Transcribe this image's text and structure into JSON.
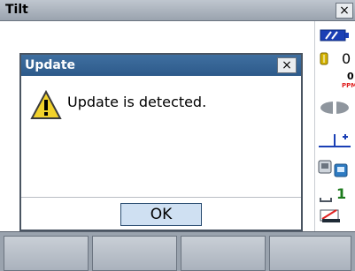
{
  "window": {
    "title": "Tilt",
    "close_glyph": "×"
  },
  "dialog": {
    "title": "Update",
    "close_glyph": "×",
    "message": "Update is detected.",
    "icon": "warning-icon"
  },
  "buttons": {
    "ok": "OK"
  },
  "sidebar": {
    "icons": [
      "battery-icon",
      "target-icon",
      "ppm-icon",
      "prism-icon",
      "tilt-icon",
      "level-icon",
      "page-indicator-icon",
      "no-edit-icon"
    ],
    "target_value": "0",
    "ppm_value": "0",
    "ppm_label": "PPM",
    "page_number": "1"
  },
  "softkeys": [
    "",
    "",
    "",
    ""
  ],
  "colors": {
    "title_bar": "#9aa3ae",
    "dialog_title": "#2d5a8a",
    "ok_button": "#cfe0f2",
    "sidebar_accent": "#1a3fb5",
    "warning": "#f2d22b"
  }
}
